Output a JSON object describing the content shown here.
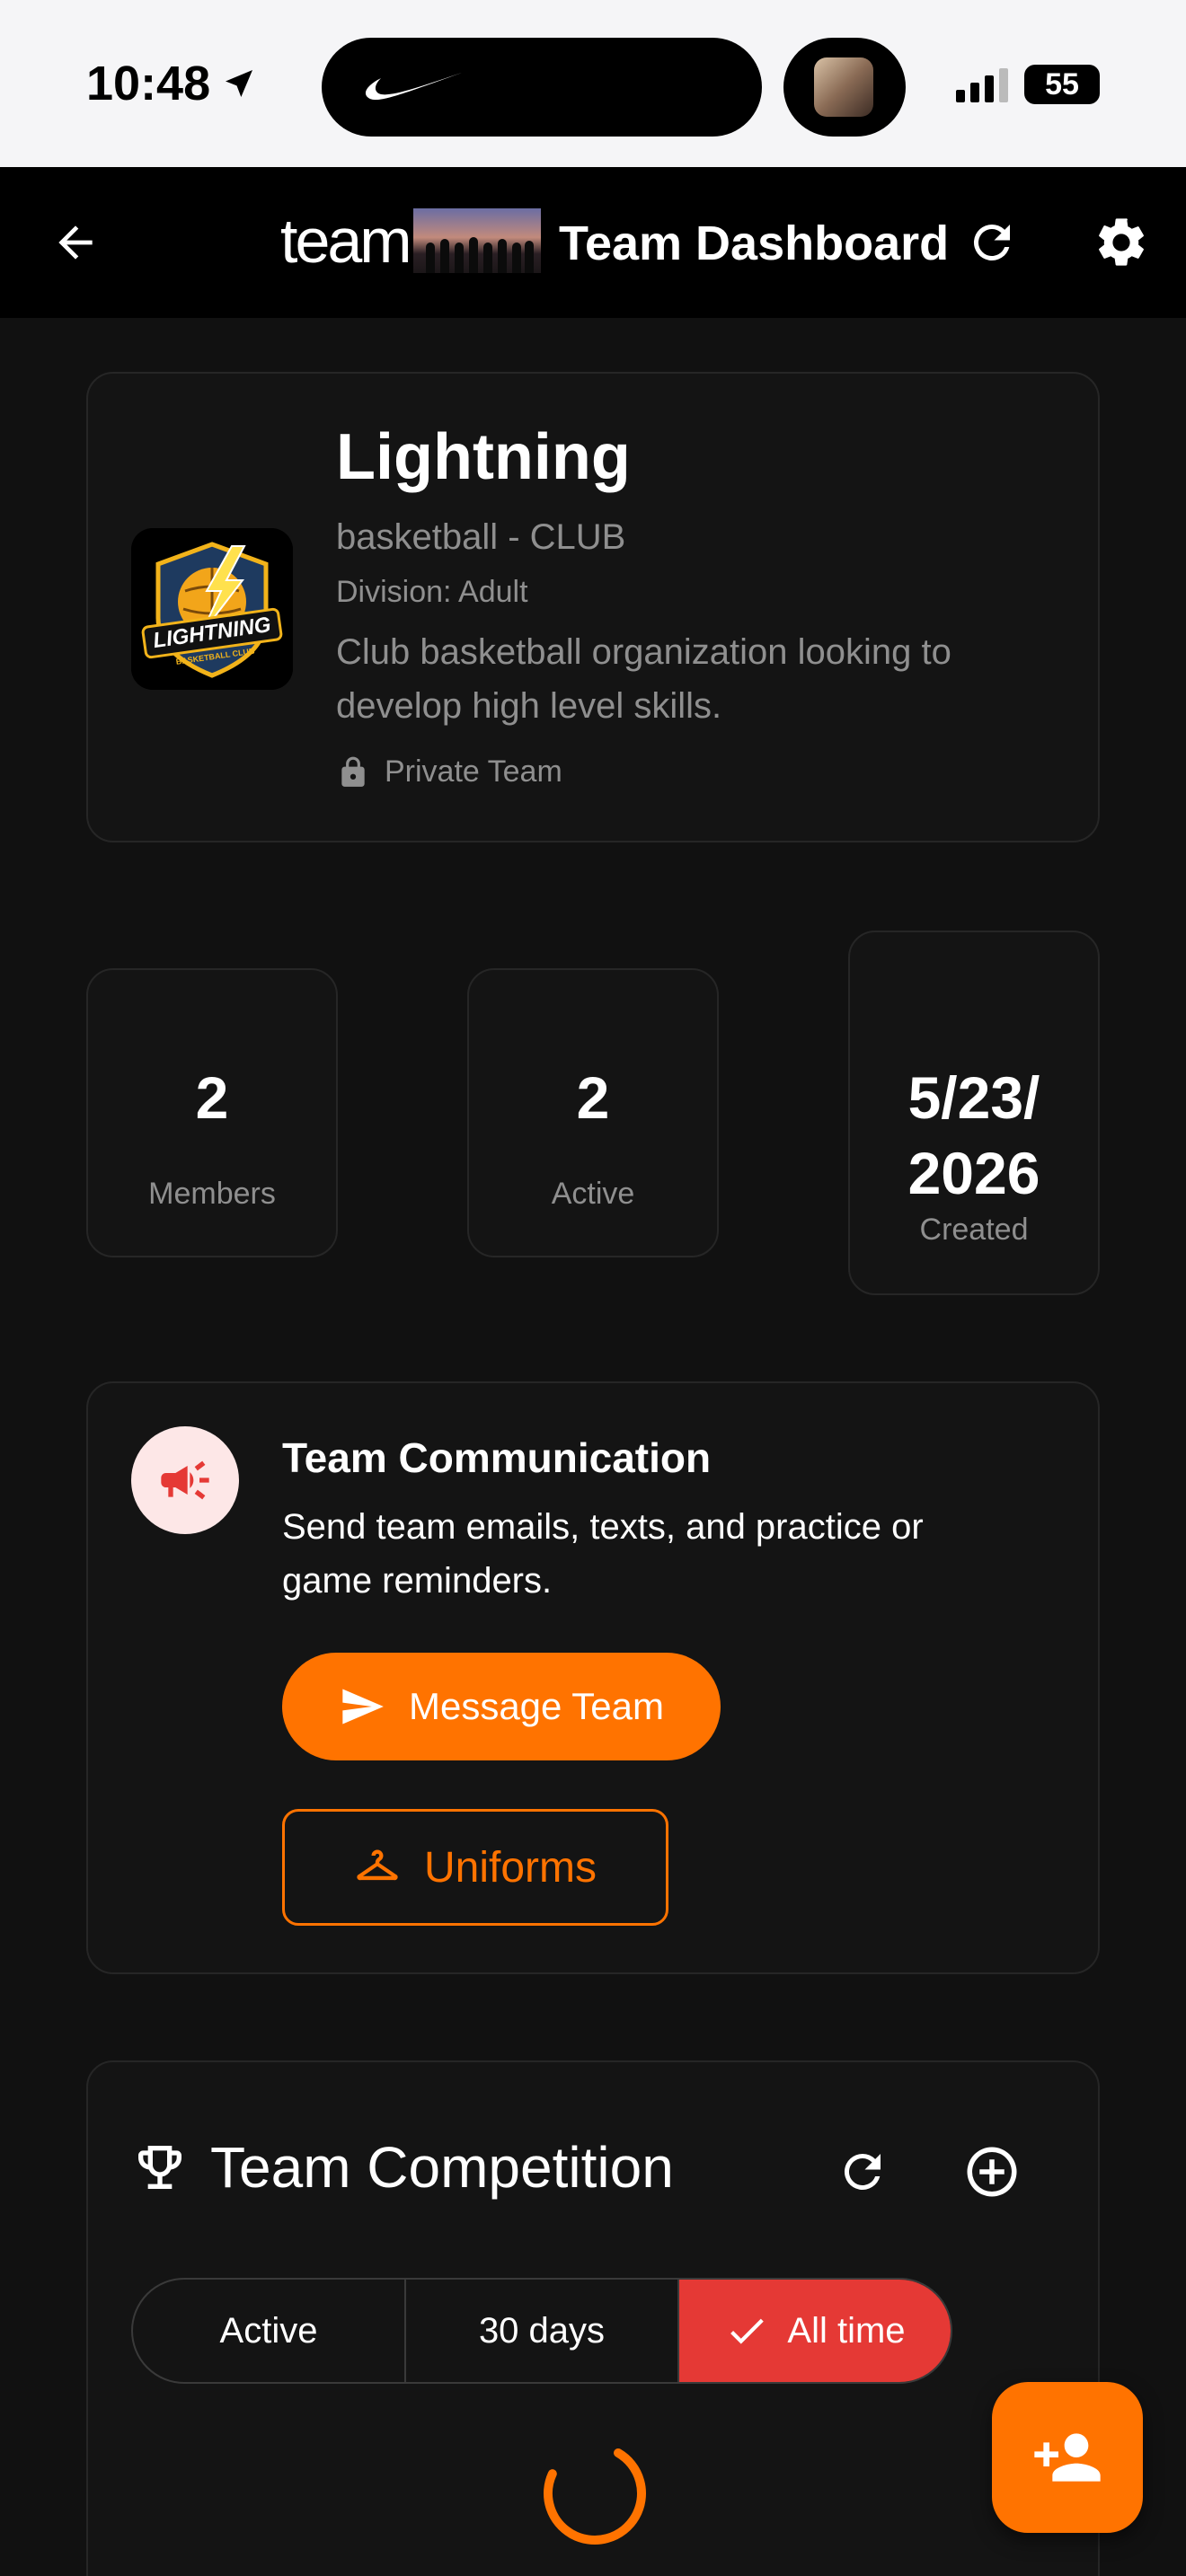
{
  "status_bar": {
    "time": "10:48",
    "battery": "55"
  },
  "app_bar": {
    "brand_word": "team",
    "title": "Team Dashboard"
  },
  "team": {
    "name": "Lightning",
    "sport": "basketball - CLUB",
    "division": "Division: Adult",
    "description": "Club basketball organization looking to develop high level skills.",
    "privacy": "Private Team",
    "logo_text": "LIGHTNING",
    "logo_subtext": "BASKETBALL CLUB"
  },
  "stats": [
    {
      "value": "2",
      "label": "Members"
    },
    {
      "value": "2",
      "label": "Active"
    },
    {
      "value_line1": "5/23/",
      "value_line2": "2026",
      "label": "Created"
    }
  ],
  "communication": {
    "title": "Team Communication",
    "description": "Send team emails, texts, and practice or game reminders.",
    "message_button": "Message Team",
    "uniforms_button": "Uniforms"
  },
  "competition": {
    "title": "Team Competition",
    "filters": [
      {
        "label": "Active",
        "selected": false
      },
      {
        "label": "30 days",
        "selected": false
      },
      {
        "label": "All time",
        "selected": true
      }
    ]
  },
  "icons": {
    "back": "arrow-left-icon",
    "refresh": "refresh-icon",
    "settings": "gear-icon",
    "lock": "lock-icon",
    "megaphone": "megaphone-icon",
    "send": "send-icon",
    "hanger": "hanger-icon",
    "trophy": "trophy-icon",
    "add": "add-circle-icon",
    "check": "check-icon",
    "add_person": "person-add-icon"
  },
  "colors": {
    "accent": "#ff7300",
    "selected_filter": "#e53935",
    "background": "#111111",
    "card": "#141414"
  }
}
